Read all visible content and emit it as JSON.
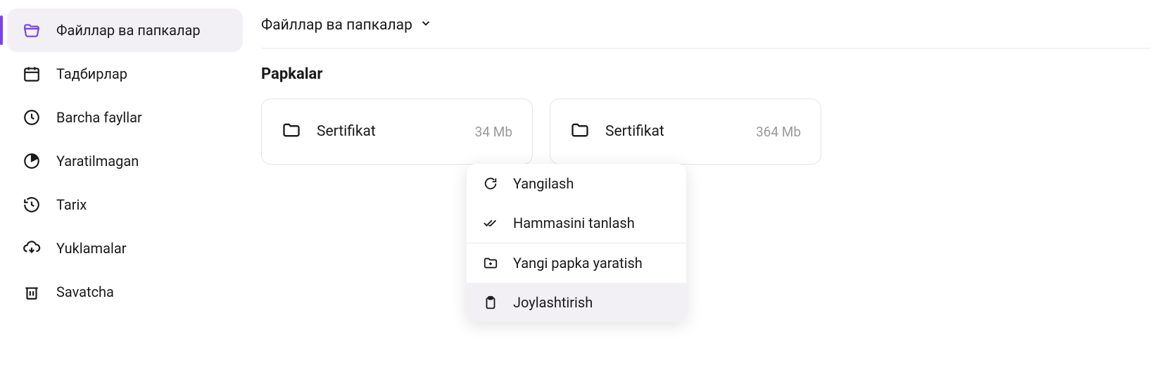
{
  "sidebar": {
    "items": [
      {
        "label": "Файллар ва папкалар"
      },
      {
        "label": "Тадбирлар"
      },
      {
        "label": "Barcha fayllar"
      },
      {
        "label": "Yaratilmagan"
      },
      {
        "label": "Tarix"
      },
      {
        "label": "Yuklamalar"
      },
      {
        "label": "Savatcha"
      }
    ]
  },
  "breadcrumb": {
    "title": "Файллар ва папкалар"
  },
  "section": {
    "title": "Papkalar"
  },
  "folders": [
    {
      "name": "Sertifikat",
      "size": "34 Mb"
    },
    {
      "name": "Sertifikat",
      "size": "364 Mb"
    }
  ],
  "context_menu": {
    "items": [
      {
        "label": "Yangilash"
      },
      {
        "label": "Hammasini tanlash"
      },
      {
        "label": "Yangi papka yaratish"
      },
      {
        "label": "Joylashtirish"
      }
    ]
  }
}
